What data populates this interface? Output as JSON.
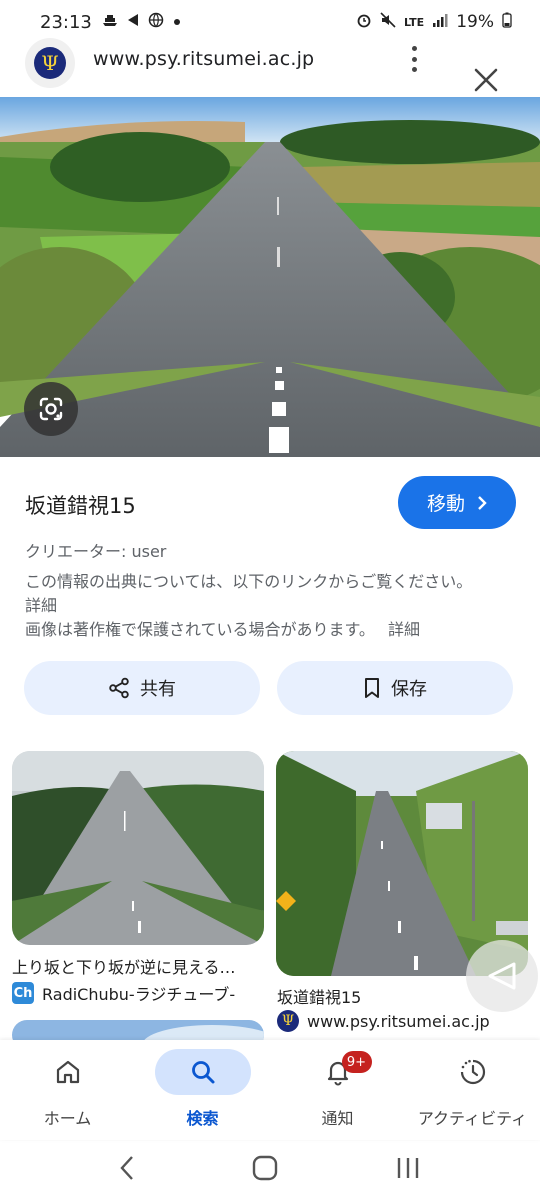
{
  "status": {
    "time": "23:13",
    "network": "LTE",
    "battery": "19%"
  },
  "header": {
    "url": "www.psy.ritsumei.ac.jp",
    "logo_glyph": "Ψ"
  },
  "image": {
    "title": "坂道錯視15",
    "visit_label": "移動",
    "creator": "クリエーター: user",
    "source_text": "この情報の出典については、以下のリンクからご覧ください。",
    "source_more": "詳細",
    "copyright_text": "画像は著作権で保護されている場合があります。",
    "copyright_more": "詳細"
  },
  "actions": {
    "share_label": "共有",
    "save_label": "保存"
  },
  "related": [
    {
      "title": "上り坂と下り坂が逆に見える…",
      "source": "RadiChubu-ラジチューブ-",
      "source_logo": "Ch"
    },
    {
      "title": "坂道錯視15",
      "source": "www.psy.ritsumei.ac.jp",
      "source_logo": "Ψ"
    }
  ],
  "bottom_nav": [
    {
      "label": "ホーム",
      "icon": "home-icon"
    },
    {
      "label": "検索",
      "icon": "search-icon",
      "active": true
    },
    {
      "label": "通知",
      "icon": "bell-icon",
      "badge": "9+"
    },
    {
      "label": "アクティビティ",
      "icon": "activity-icon"
    }
  ],
  "colors": {
    "accent": "#1a73e8",
    "pill_bg": "#e8f0fe",
    "badge": "#c5221f"
  }
}
